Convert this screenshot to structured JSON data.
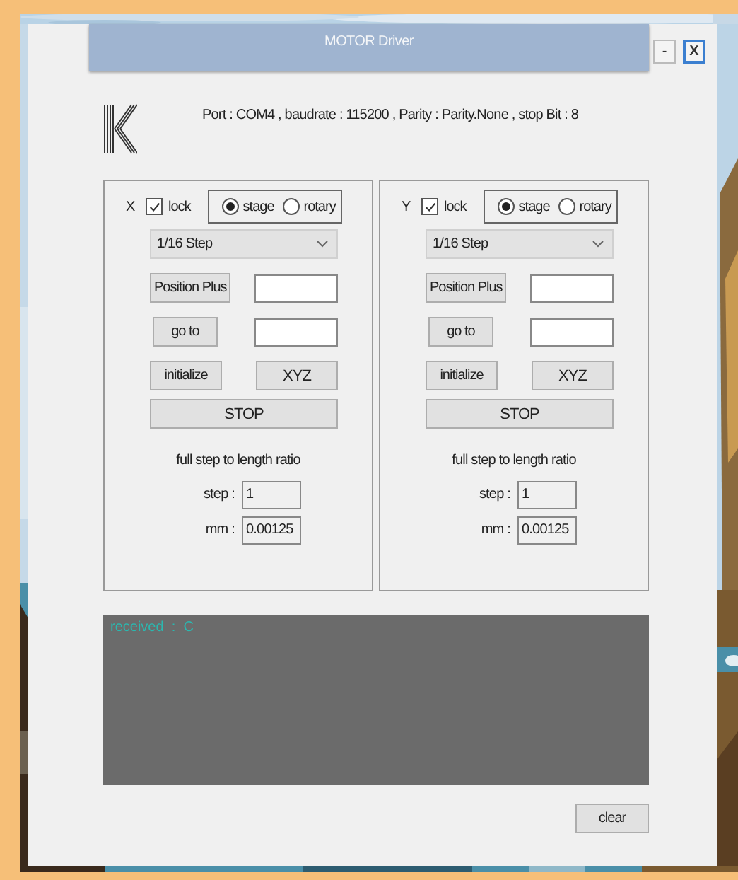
{
  "window": {
    "title": "MOTOR Driver",
    "minimize_label": "-",
    "close_label": "X"
  },
  "connection": "Port : COM4 , baudrate : 115200 , Parity : Parity.None , stop Bit : 8",
  "axes": [
    {
      "label": "X",
      "lock_label": "lock",
      "locked": true,
      "modes": [
        {
          "label": "stage",
          "selected": true
        },
        {
          "label": "rotary",
          "selected": false
        }
      ],
      "step_mode": "1/16 Step",
      "position_plus_label": "Position Plus",
      "goto_label": "go to",
      "initialize_label": "initialize",
      "xyz_label": "XYZ",
      "stop_label": "STOP",
      "ratio_title": "full step to length ratio",
      "step_label": "step :",
      "step_value": "1",
      "mm_label": "mm :",
      "mm_value": "0.00125"
    },
    {
      "label": "Y",
      "lock_label": "lock",
      "locked": true,
      "modes": [
        {
          "label": "stage",
          "selected": true
        },
        {
          "label": "rotary",
          "selected": false
        }
      ],
      "step_mode": "1/16 Step",
      "position_plus_label": "Position Plus",
      "goto_label": "go to",
      "initialize_label": "initialize",
      "xyz_label": "XYZ",
      "stop_label": "STOP",
      "ratio_title": "full step to length ratio",
      "step_label": "step :",
      "step_value": "1",
      "mm_label": "mm :",
      "mm_value": "0.00125"
    }
  ],
  "console": {
    "lines": [
      "received  :  C"
    ]
  },
  "clear_label": "clear"
}
